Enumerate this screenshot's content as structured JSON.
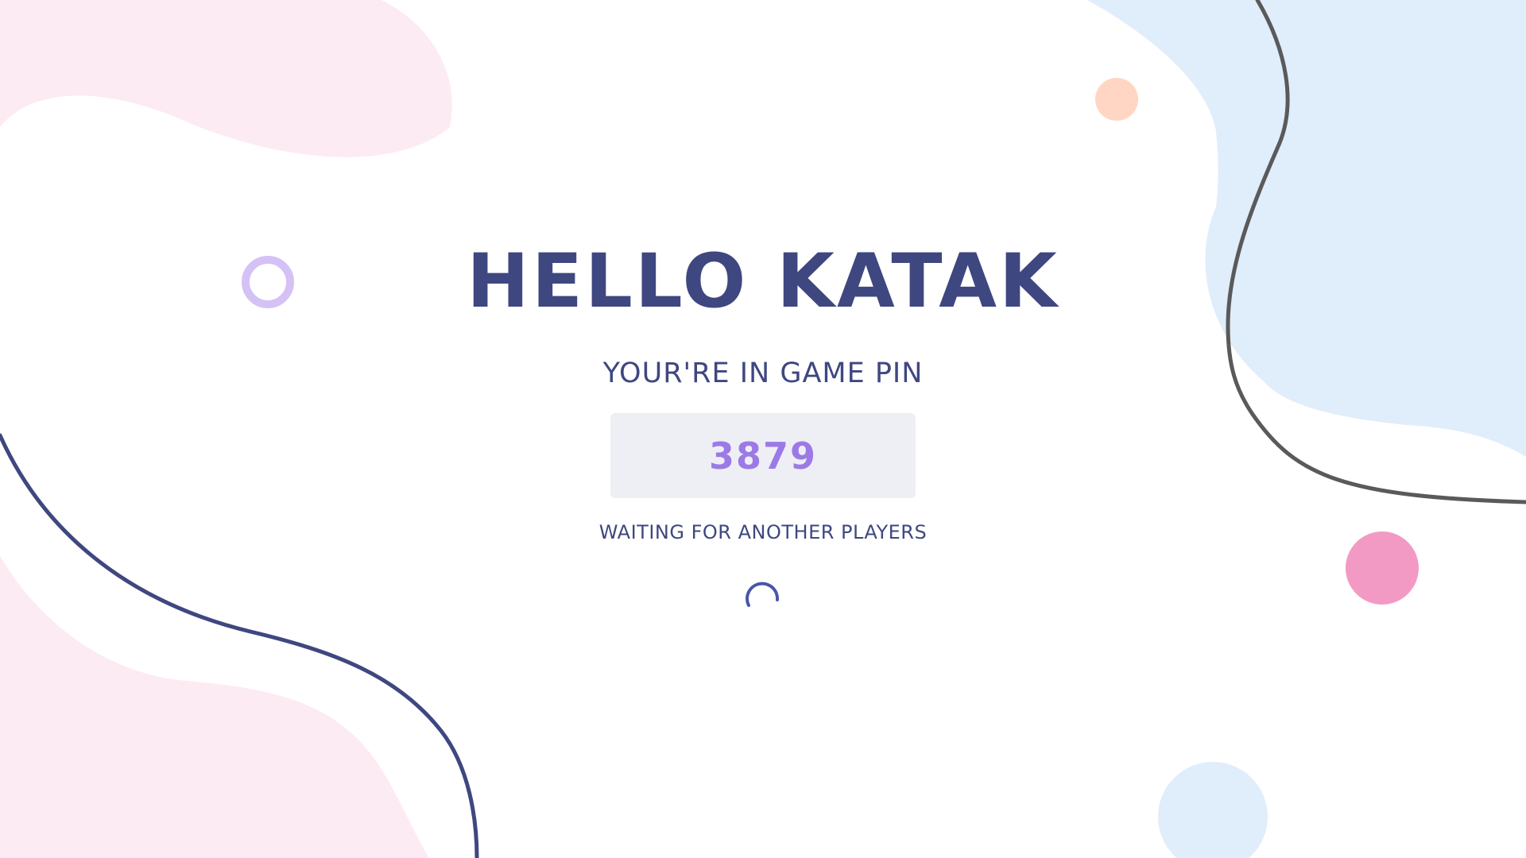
{
  "greeting": {
    "text": "HELLO KATAK"
  },
  "game_pin": {
    "label": "YOUR'RE IN GAME PIN",
    "value": "3879"
  },
  "status": {
    "text": "WAITING FOR ANOTHER PLAYERS",
    "indicator": "loading-spinner"
  },
  "colors": {
    "text_primary": "#3f4780",
    "pin_text": "#9c7ae6",
    "pin_box": "#eeeff5",
    "blob_pink": "#fdebf3",
    "blob_blue": "#e0edfb",
    "dot_peach": "#ffd6c3",
    "dot_pink": "#f29ac4",
    "ring_lavender": "#d4c2f6"
  }
}
